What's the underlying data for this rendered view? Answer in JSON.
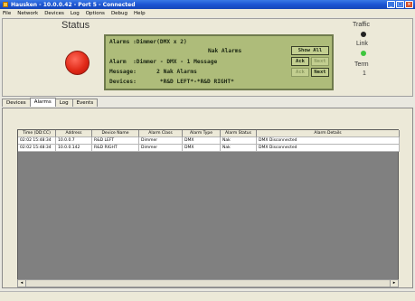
{
  "window": {
    "title": "Hausken - 10.0.0.42 - Port 5 - Connected",
    "colors": {
      "titlebar": "#1c55d3",
      "lcd_bg": "#aebc7a",
      "status_lamp": "#e12a18",
      "link_led": "#3ec63e"
    }
  },
  "menu": [
    "File",
    "Network",
    "Devices",
    "Log",
    "Options",
    "Debug",
    "Help"
  ],
  "status_panel": {
    "status_label": "Status",
    "lcd": {
      "line1": "Alarms :Dimmer(DMX x 2)",
      "line2": "Nak Alarms",
      "line3": "Alarm  :Dimmer - DMX - 1 Message",
      "line4": "Message:      2 Nak Alarms",
      "line5": "Devices:       *R&D LEFT*-*R&D RIGHT*",
      "show_all": "Show All",
      "ack1": "Ack",
      "next1": "Next",
      "ack2": "Ack",
      "next2": "Next"
    },
    "traffic_label": "Traffic",
    "link_label": "Link",
    "term_label": "Term",
    "term_value": "1"
  },
  "tabs": [
    "Devices",
    "Alarms",
    "Log",
    "Events"
  ],
  "active_tab": "Alarms",
  "table": {
    "columns": [
      "Time (DD:CC)",
      "Address",
      "Device Name",
      "Alarm Class",
      "Alarm Type",
      "Alarm Status",
      "Alarm Details"
    ],
    "rows": [
      [
        "02:02 15:48:34",
        "10.0.0.7",
        "R&D LEFT",
        "Dimmer",
        "DMX",
        "Nak",
        "DMX Disconnected"
      ],
      [
        "02:02 15:48:34",
        "10.0.0.142",
        "R&D RIGHT",
        "Dimmer",
        "DMX",
        "Nak",
        "DMX Disconnected"
      ]
    ]
  }
}
